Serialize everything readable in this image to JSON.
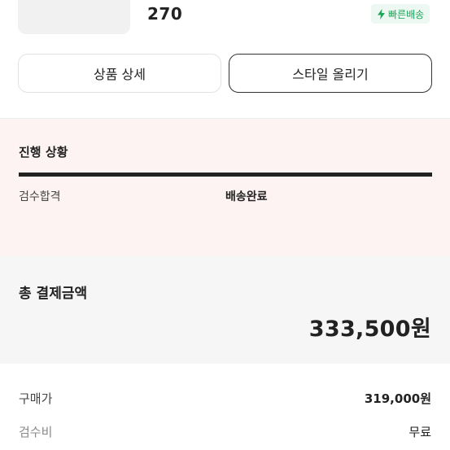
{
  "product": {
    "size": "270",
    "fast_delivery_badge": "빠른배송"
  },
  "actions": {
    "product_detail": "상품 상세",
    "post_style": "스타일 올리기"
  },
  "progress": {
    "title": "진행 상황",
    "step_inspection": "검수합격",
    "step_delivered": "배송완료",
    "completion": 1.0
  },
  "payment": {
    "total_label": "총 결제금액",
    "total_amount": "333,500원",
    "purchase_price_label": "구매가",
    "purchase_price": "319,000원",
    "inspection_fee_label": "검수비",
    "inspection_fee": "무료"
  },
  "colors": {
    "accent_green": "#22a35a",
    "progress_bg": "#fdf3f2",
    "summary_bg": "#f6f6f6"
  }
}
